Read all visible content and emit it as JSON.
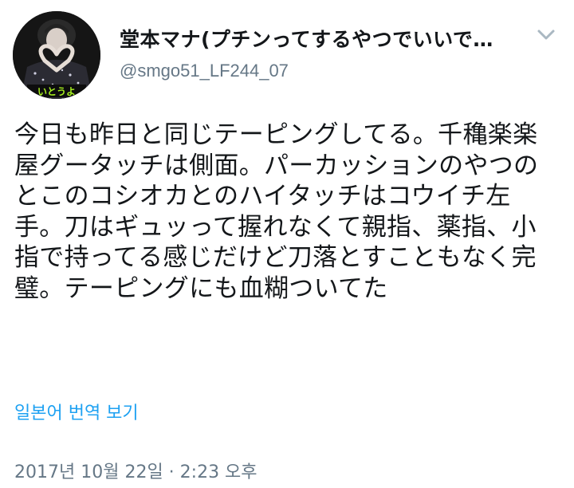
{
  "tweet": {
    "display_name": "堂本マナ(プチンってするやつでいいで…",
    "handle": "@smgo51_LF244_07",
    "text": "今日も昨日と同じテーピングしてる。千穐楽楽屋グータッチは側面。パーカッションのやつのとこのコシオカとのハイタッチはコウイチ左手。刀はギュッって握れなくて親指、薬指、小指で持ってる感じだけど刀落とすこともなく完璧。テーピングにも血糊ついてた",
    "translate_label": "일본어 번역 보기",
    "timestamp": "2017년 10월 22일 · 2:23 오후",
    "avatar_caption": "いとうよ"
  },
  "colors": {
    "link": "#1da1f2",
    "secondary_text": "#657786",
    "primary_text": "#14171a",
    "caret": "#aab8c2",
    "avatar_caption": "#a6f020"
  },
  "icons": {
    "caret": "chevron-down-icon"
  }
}
